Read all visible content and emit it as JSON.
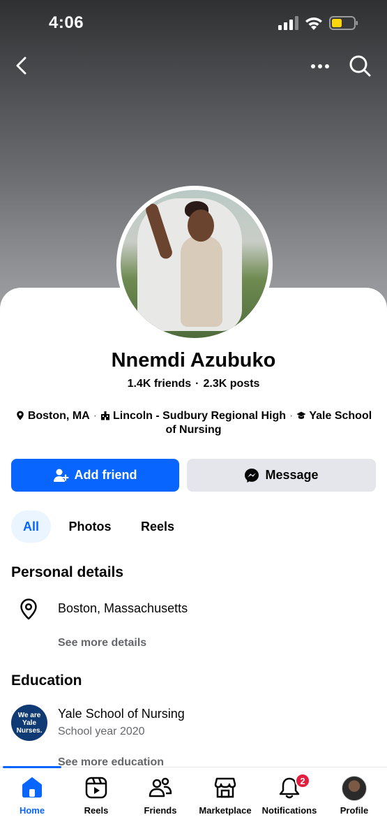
{
  "status_bar": {
    "time": "4:06"
  },
  "profile": {
    "name": "Nnemdi Azubuko",
    "friends": "1.4K friends",
    "posts": "2.3K posts",
    "separator": "·"
  },
  "intro": {
    "location": "Boston, MA",
    "school": "Lincoln - Sudbury Regional High",
    "college": "Yale School of Nursing",
    "separator": "·"
  },
  "actions": {
    "add_friend": "Add friend",
    "message": "Message"
  },
  "tabs": [
    {
      "label": "All",
      "active": true
    },
    {
      "label": "Photos",
      "active": false
    },
    {
      "label": "Reels",
      "active": false
    }
  ],
  "personal_details": {
    "title": "Personal details",
    "location": "Boston, Massachusetts",
    "see_more": "See more details"
  },
  "education": {
    "title": "Education",
    "logo_text": "We are Yale Nurses.",
    "school": "Yale School of Nursing",
    "year": "School year 2020",
    "see_more": "See more education"
  },
  "bottom_nav": [
    {
      "label": "Home",
      "icon": "home-icon",
      "active": true
    },
    {
      "label": "Reels",
      "icon": "reels-icon",
      "active": false
    },
    {
      "label": "Friends",
      "icon": "friends-icon",
      "active": false
    },
    {
      "label": "Marketplace",
      "icon": "marketplace-icon",
      "active": false
    },
    {
      "label": "Notifications",
      "icon": "bell-icon",
      "active": false,
      "badge": "2"
    },
    {
      "label": "Profile",
      "icon": "profile-avatar",
      "active": false
    }
  ],
  "colors": {
    "primary": "#0866ff",
    "secondary_button": "#e4e6eb",
    "badge": "#e41e3f",
    "muted_text": "#65676b"
  }
}
